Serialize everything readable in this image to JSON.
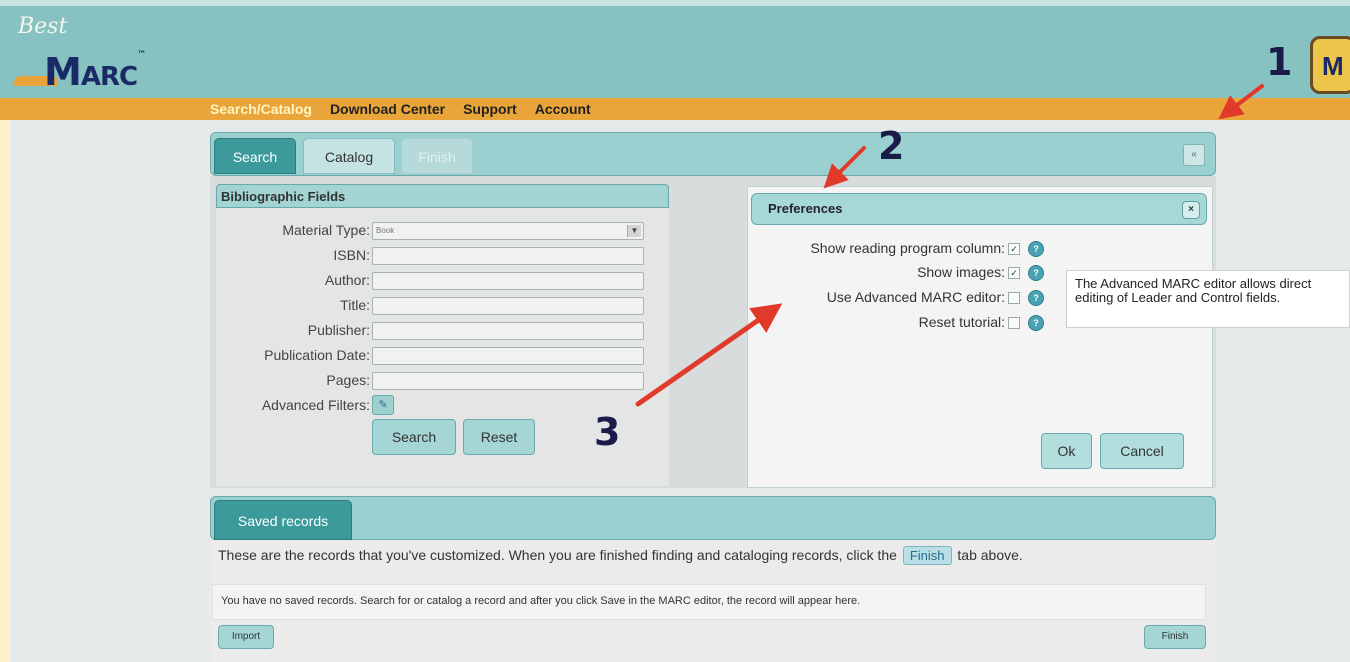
{
  "brand": {
    "logo_top": "Best",
    "logo_main": "M",
    "logo_rest": "ARC",
    "logo_tm": "™",
    "corner_icon": "M"
  },
  "nav": {
    "items": [
      {
        "label": "Search/Catalog",
        "active": true
      },
      {
        "label": "Download Center",
        "active": false
      },
      {
        "label": "Support",
        "active": false
      },
      {
        "label": "Account",
        "active": false
      }
    ]
  },
  "tabs": {
    "search": "Search",
    "catalog": "Catalog",
    "finish": "Finish",
    "collapse_icon": "«"
  },
  "bib": {
    "title": "Bibliographic Fields",
    "fields": [
      {
        "label": "Material Type:",
        "value": "Book",
        "type": "select"
      },
      {
        "label": "ISBN:",
        "value": ""
      },
      {
        "label": "Author:",
        "value": ""
      },
      {
        "label": "Title:",
        "value": ""
      },
      {
        "label": "Publisher:",
        "value": ""
      },
      {
        "label": "Publication Date:",
        "value": ""
      },
      {
        "label": "Pages:",
        "value": ""
      }
    ],
    "advanced_filters_label": "Advanced Filters:",
    "search_btn": "Search",
    "reset_btn": "Reset"
  },
  "preferences": {
    "title": "Preferences",
    "close_icon": "×",
    "options": [
      {
        "label": "Show reading program column:",
        "checked": true
      },
      {
        "label": "Show images:",
        "checked": true
      },
      {
        "label": "Use Advanced MARC editor:",
        "checked": false
      },
      {
        "label": "Reset tutorial:",
        "checked": false
      }
    ],
    "help_glyph": "?",
    "tooltip": "The Advanced MARC editor allows direct editing of Leader and Control fields.",
    "ok_btn": "Ok",
    "cancel_btn": "Cancel"
  },
  "saved": {
    "tab": "Saved records",
    "desc_before": "These are the records that you've customized. When you are finished finding and cataloging records, click the",
    "desc_finish": "Finish",
    "desc_after": "tab above.",
    "empty_msg": "You have no saved records. Search for or catalog a record and after you click Save in the MARC editor, the record will appear here.",
    "import_btn": "Import",
    "finish_btn": "Finish"
  },
  "annotations": [
    "1",
    "2",
    "3"
  ],
  "colors": {
    "header_teal": "#86c2c2",
    "nav_orange": "#e9a43a",
    "tab_active": "#3d9a9a",
    "arrow_red": "#e03a2b",
    "annotation_navy": "#1b1b4a"
  }
}
